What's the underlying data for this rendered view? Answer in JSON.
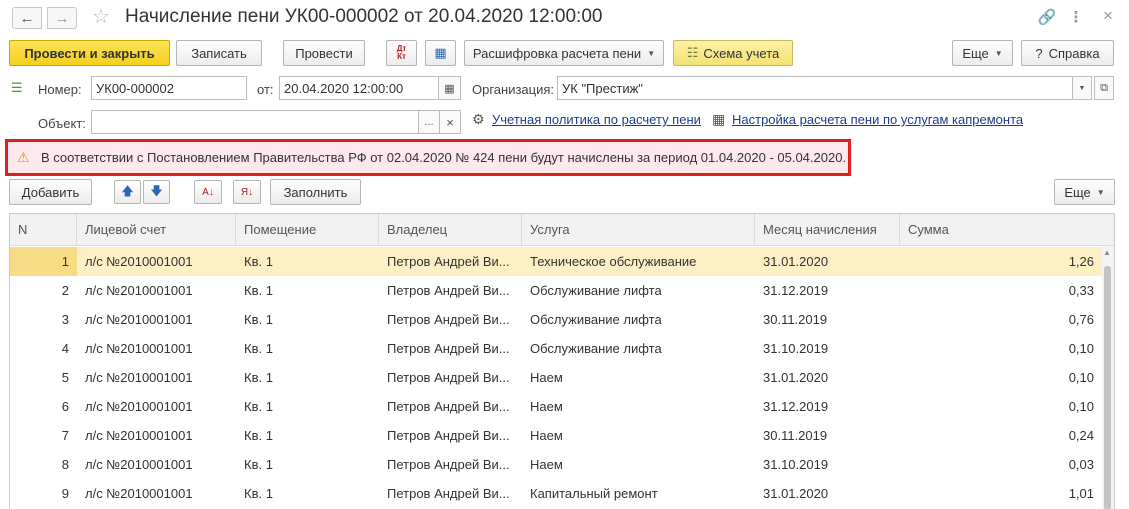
{
  "window": {
    "title": "Начисление пени УК00-000002 от 20.04.2020 12:00:00",
    "back_icon": "arrow-left",
    "forward_icon": "arrow-right",
    "favorite_icon": "star-outline",
    "link_icon": "link",
    "more_icon": "vertical-dots",
    "close_icon": "close-x"
  },
  "toolbar": {
    "post_close": "Провести и закрыть",
    "save": "Записать",
    "post": "Провести",
    "dt_kt_icon": "Дт Кт",
    "structure_icon": "structure",
    "calc_breakdown": "Расшифровка расчета пени",
    "accounting_scheme": "Схема учета",
    "more": "Еще",
    "help": "Справка",
    "help_icon": "?"
  },
  "form": {
    "number_label": "Номер:",
    "number_value": "УК00-000002",
    "date_label": "от:",
    "date_value": "20.04.2020 12:00:00",
    "org_label": "Организация:",
    "org_value": "УК \"Престиж\"",
    "object_label": "Объект:",
    "object_value": "",
    "link_policy": "Учетная политика по расчету пени",
    "link_settings": "Настройка расчета пени по услугам капремонта"
  },
  "alert": {
    "text": "В соответствии с Постановлением Правительства РФ от 02.04.2020 № 424 пени будут начислены за период 01.04.2020 - 05.04.2020."
  },
  "table_toolbar": {
    "add": "Добавить",
    "fill": "Заполнить",
    "more": "Еще"
  },
  "table": {
    "columns": [
      "N",
      "Лицевой счет",
      "Помещение",
      "Владелец",
      "Услуга",
      "Месяц начисления",
      "Сумма"
    ],
    "rows": [
      [
        "1",
        "л/с №2010001001",
        "Кв. 1",
        "Петров Андрей Ви...",
        "Техническое обслуживание",
        "31.01.2020",
        "1,26"
      ],
      [
        "2",
        "л/с №2010001001",
        "Кв. 1",
        "Петров Андрей Ви...",
        "Обслуживание лифта",
        "31.12.2019",
        "0,33"
      ],
      [
        "3",
        "л/с №2010001001",
        "Кв. 1",
        "Петров Андрей Ви...",
        "Обслуживание лифта",
        "30.11.2019",
        "0,76"
      ],
      [
        "4",
        "л/с №2010001001",
        "Кв. 1",
        "Петров Андрей Ви...",
        "Обслуживание лифта",
        "31.10.2019",
        "0,10"
      ],
      [
        "5",
        "л/с №2010001001",
        "Кв. 1",
        "Петров Андрей Ви...",
        "Наем",
        "31.01.2020",
        "0,10"
      ],
      [
        "6",
        "л/с №2010001001",
        "Кв. 1",
        "Петров Андрей Ви...",
        "Наем",
        "31.12.2019",
        "0,10"
      ],
      [
        "7",
        "л/с №2010001001",
        "Кв. 1",
        "Петров Андрей Ви...",
        "Наем",
        "30.11.2019",
        "0,24"
      ],
      [
        "8",
        "л/с №2010001001",
        "Кв. 1",
        "Петров Андрей Ви...",
        "Наем",
        "31.10.2019",
        "0,03"
      ],
      [
        "9",
        "л/с №2010001001",
        "Кв. 1",
        "Петров Андрей Ви...",
        "Капитальный ремонт",
        "31.01.2020",
        "1,01"
      ]
    ]
  }
}
